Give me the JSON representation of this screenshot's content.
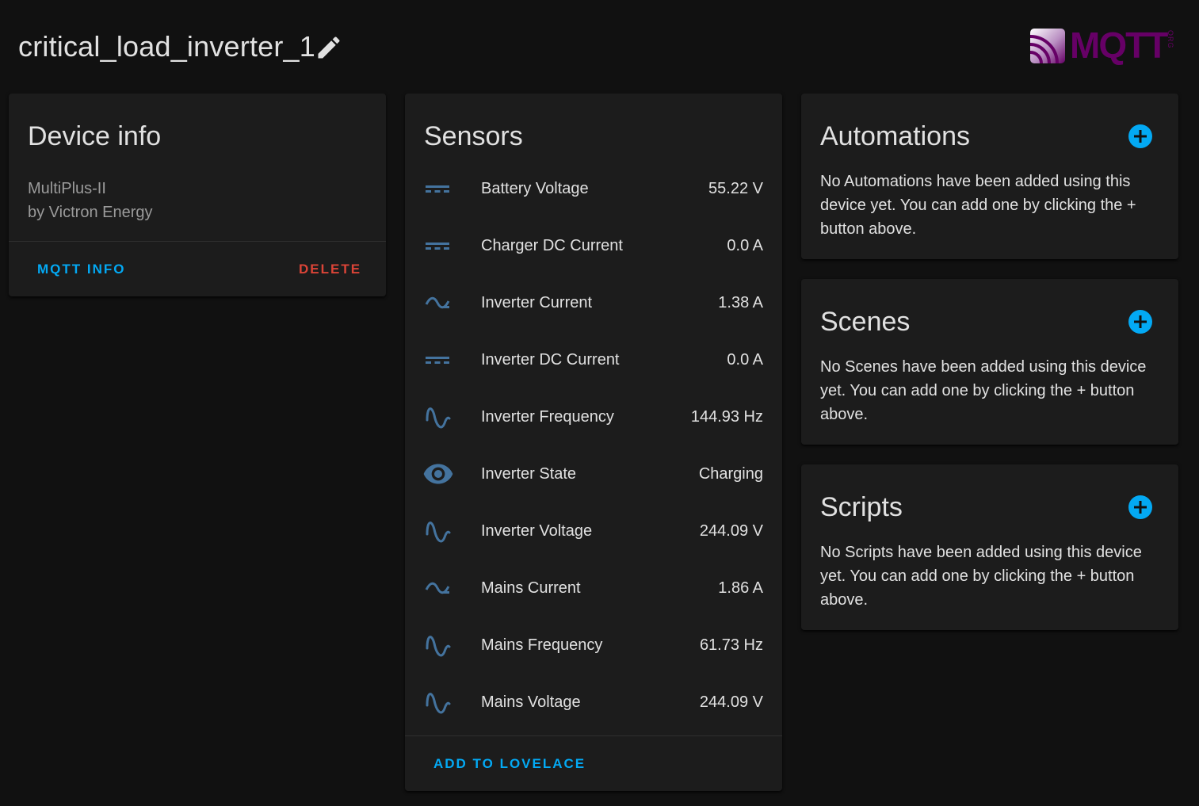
{
  "header": {
    "title": "critical_load_inverter_1",
    "edit_icon": "pencil-icon",
    "logo": {
      "text": "MQTT",
      "suffix": "ORG",
      "color": "#660066"
    }
  },
  "device_info": {
    "title": "Device info",
    "model": "MultiPlus-II",
    "manufacturer": "by Victron Energy",
    "mqtt_info_label": "MQTT INFO",
    "delete_label": "DELETE"
  },
  "sensors": {
    "title": "Sensors",
    "items": [
      {
        "icon": "current-dc-icon",
        "name": "Battery Voltage",
        "value": "55.22 V"
      },
      {
        "icon": "current-dc-icon",
        "name": "Charger DC Current",
        "value": "0.0 A"
      },
      {
        "icon": "current-ac-icon",
        "name": "Inverter Current",
        "value": "1.38 A"
      },
      {
        "icon": "current-dc-icon",
        "name": "Inverter DC Current",
        "value": "0.0 A"
      },
      {
        "icon": "sine-wave-icon",
        "name": "Inverter Frequency",
        "value": "144.93 Hz"
      },
      {
        "icon": "eye-icon",
        "name": "Inverter State",
        "value": "Charging"
      },
      {
        "icon": "sine-wave-icon",
        "name": "Inverter Voltage",
        "value": "244.09 V"
      },
      {
        "icon": "current-ac-icon",
        "name": "Mains Current",
        "value": "1.86 A"
      },
      {
        "icon": "sine-wave-icon",
        "name": "Mains Frequency",
        "value": "61.73 Hz"
      },
      {
        "icon": "sine-wave-icon",
        "name": "Mains Voltage",
        "value": "244.09 V"
      }
    ],
    "add_label": "ADD TO LOVELACE"
  },
  "automations": {
    "title": "Automations",
    "text": "No Automations have been added using this device yet. You can add one by clicking the + button above."
  },
  "scenes": {
    "title": "Scenes",
    "text": "No Scenes have been added using this device yet. You can add one by clicking the + button above."
  },
  "scripts": {
    "title": "Scripts",
    "text": "No Scripts have been added using this device yet. You can add one by clicking the + button above."
  },
  "colors": {
    "background": "#111111",
    "card": "#1c1c1c",
    "accent": "#03a9f4",
    "danger": "#db4437",
    "icon": "#44739e",
    "secondary_text": "#9b9b9b"
  }
}
